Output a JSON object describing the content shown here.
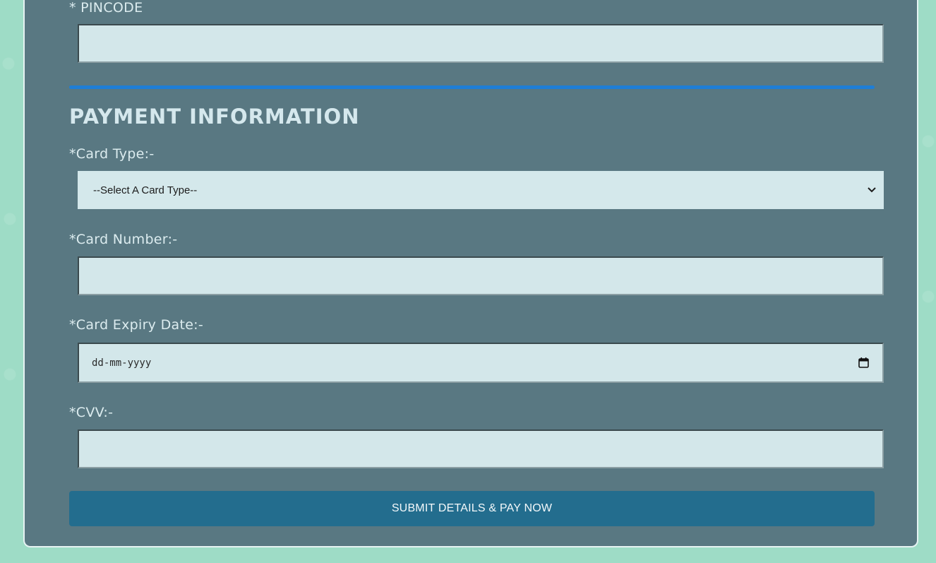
{
  "address": {
    "pincode_label": "* PINCODE",
    "pincode_value": ""
  },
  "payment": {
    "heading": "PAYMENT INFORMATION",
    "card_type_label": "*Card Type:-",
    "card_type_selected": "--Select A Card Type--",
    "card_number_label": "*Card Number:-",
    "card_number_value": "",
    "expiry_label": "*Card Expiry Date:-",
    "expiry_placeholder": "dd-mm-yyyy",
    "cvv_label": "*CVV:-",
    "cvv_value": ""
  },
  "submit_label": "SUBMIT DETAILS & PAY NOW",
  "colors": {
    "page_background": "#9edcc6",
    "card_background": "#597882",
    "field_background": "#d3e7ea",
    "divider": "#1e7ed6",
    "submit_button": "#236d8e"
  },
  "icons": {
    "select_arrow": "chevron-down-icon",
    "date_picker": "calendar-icon"
  }
}
